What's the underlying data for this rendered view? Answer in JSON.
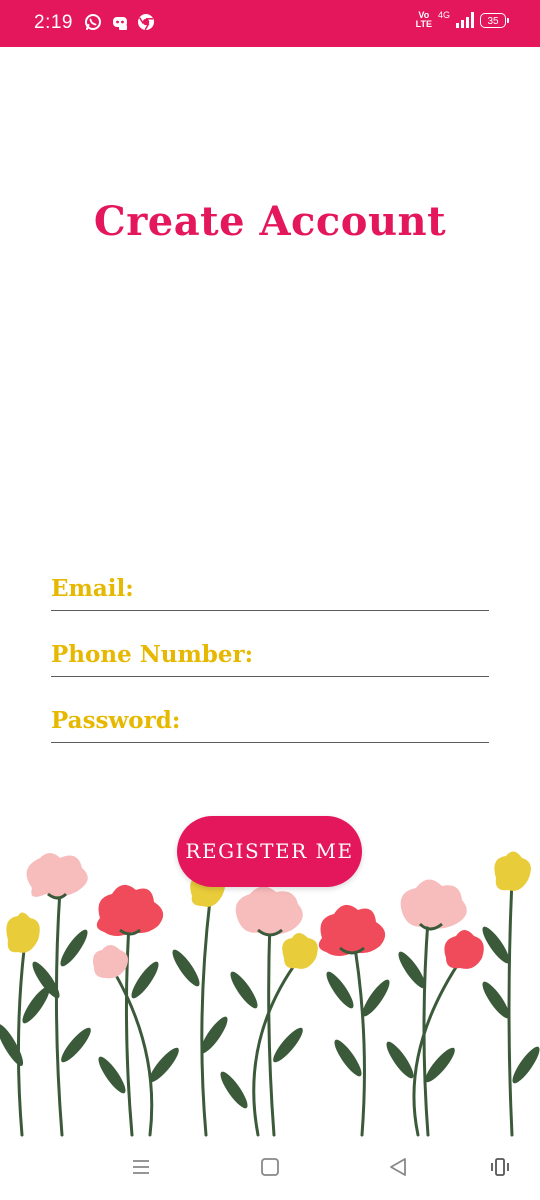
{
  "status_bar": {
    "time": "2:19",
    "volte": "Vo\nLTE",
    "network": "4G",
    "battery": "35",
    "icons": [
      "whatsapp-icon",
      "discord-icon",
      "chrome-icon",
      "signal-icon",
      "battery-icon"
    ],
    "background": "#e5175c"
  },
  "title": "Create Account",
  "fields": {
    "email_label": "Email:",
    "phone_label": "Phone Number:",
    "password_label": "Password:"
  },
  "register_button": "REGISTER ME",
  "nav_bar": {
    "icons": [
      "menu-icon",
      "home-square-icon",
      "back-triangle-icon",
      "vibrate-icon"
    ]
  },
  "colors": {
    "accent": "#e5175c",
    "label": "#e6b800",
    "leaf": "#3b5a3a"
  }
}
